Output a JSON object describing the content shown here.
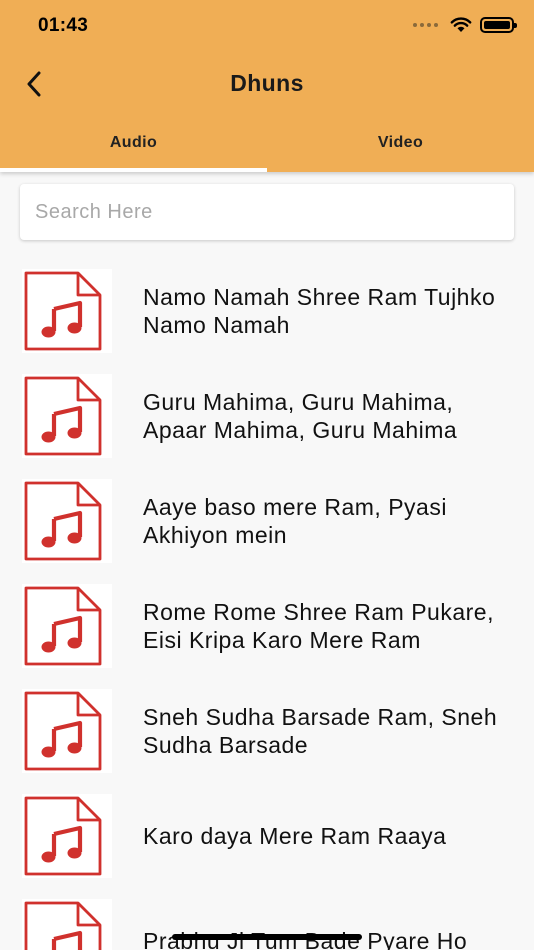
{
  "status_bar": {
    "time": "01:43"
  },
  "header": {
    "title": "Dhuns",
    "back_icon": "chevron-left-icon"
  },
  "tabs": [
    {
      "label": "Audio",
      "active": true
    },
    {
      "label": "Video",
      "active": false
    }
  ],
  "search": {
    "placeholder": "Search Here",
    "value": ""
  },
  "items": [
    {
      "title": "Namo Namah Shree Ram Tujhko Namo Namah",
      "icon": "audio-file-icon"
    },
    {
      "title": "Guru Mahima, Guru Mahima, Apaar Mahima, Guru Mahima",
      "icon": "audio-file-icon"
    },
    {
      "title": "Aaye baso mere Ram, Pyasi Akhiyon mein",
      "icon": "audio-file-icon"
    },
    {
      "title": "Rome Rome Shree Ram Pukare, Eisi Kripa Karo Mere Ram",
      "icon": "audio-file-icon"
    },
    {
      "title": "Sneh Sudha Barsade Ram, Sneh Sudha Barsade",
      "icon": "audio-file-icon"
    },
    {
      "title": "Karo daya Mere Ram Raaya",
      "icon": "audio-file-icon"
    },
    {
      "title": "Prabhu Ji Tum Bade Pyare Ho",
      "icon": "audio-file-icon"
    }
  ],
  "colors": {
    "app_bar": "#f0ae55",
    "icon_red": "#d0312d",
    "background": "#f8f8f8"
  }
}
